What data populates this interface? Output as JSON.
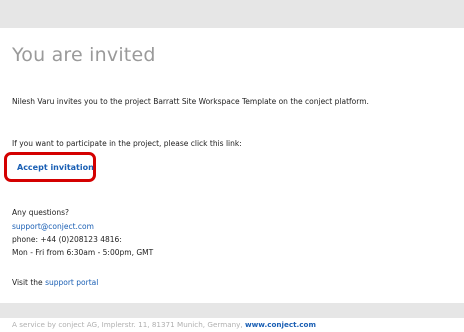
{
  "email": {
    "title": "You are invited",
    "invite_text": "Nilesh Varu invites you to the project Barratt Site Workspace Template on the conject platform.",
    "participate_text": "If you want to participate in the project, please click this link:",
    "accept_label": "Accept invitation",
    "questions_label": "Any questions?",
    "support_email": "support@conject.com",
    "phone_text": "phone: +44 (0)208123 4816:",
    "hours_text": "Mon - Fri from 6:30am - 5:00pm, GMT",
    "visit_prefix": "Visit the",
    "support_portal_label": "support portal"
  },
  "footer": {
    "text": "A service by conject AG, Implerstr. 11, 81371 Munich, Germany,",
    "link_label": "www.conject.com"
  },
  "colors": {
    "link": "#1a5fb4",
    "highlight": "#d40000",
    "band": "#e6e6e6",
    "title": "#9a9a9a"
  }
}
